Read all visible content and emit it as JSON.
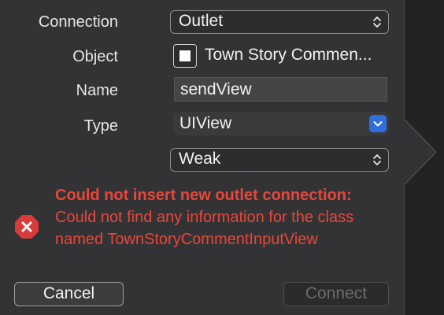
{
  "form": {
    "connection_label": "Connection",
    "connection_value": "Outlet",
    "object_label": "Object",
    "object_value": "Town Story Commen...",
    "name_label": "Name",
    "name_value": "sendView",
    "type_label": "Type",
    "type_value": "UIView",
    "storage_value": "Weak"
  },
  "error": {
    "title": "Could not insert new outlet connection:",
    "message": " Could not find any information for the class named TownStoryCommentInputView"
  },
  "buttons": {
    "cancel": "Cancel",
    "connect": "Connect"
  },
  "colors": {
    "error": "#e8463a",
    "accent": "#2f6fdc",
    "background": "#333335"
  }
}
